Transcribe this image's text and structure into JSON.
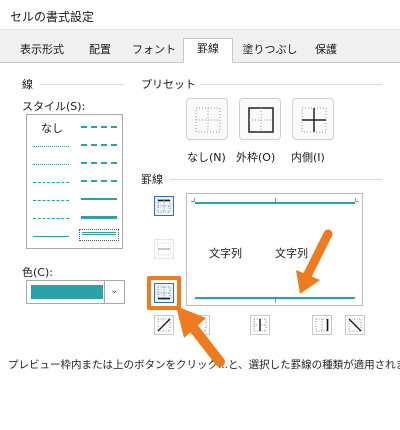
{
  "window": {
    "title": "セルの書式設定"
  },
  "tabs": [
    {
      "label": "表示形式"
    },
    {
      "label": "配置"
    },
    {
      "label": "フォント"
    },
    {
      "label": "罫線",
      "active": true
    },
    {
      "label": "塗りつぶし"
    },
    {
      "label": "保護"
    }
  ],
  "line_group": {
    "title": "線",
    "style_label": "スタイル(S):",
    "none_label": "なし",
    "color_label": "色(C):",
    "color_value": "#2ba3a6"
  },
  "preset_group": {
    "title": "プリセット",
    "items": [
      {
        "label": "なし(N)",
        "icon": "preset-none-icon"
      },
      {
        "label": "外枠(O)",
        "icon": "preset-outline-icon"
      },
      {
        "label": "内側(I)",
        "icon": "preset-inside-icon"
      }
    ]
  },
  "border_group": {
    "title": "罫線",
    "preview_text_left": "文字列",
    "preview_text_right": "文字列"
  },
  "hint_text": "プレビュー枠内または上のボタンをクリック...と、選択した罫線の種類が適用されま",
  "colors": {
    "accent": "#2ba3a6",
    "highlight": "#f07a1e",
    "selected": "#2f6fbf"
  }
}
